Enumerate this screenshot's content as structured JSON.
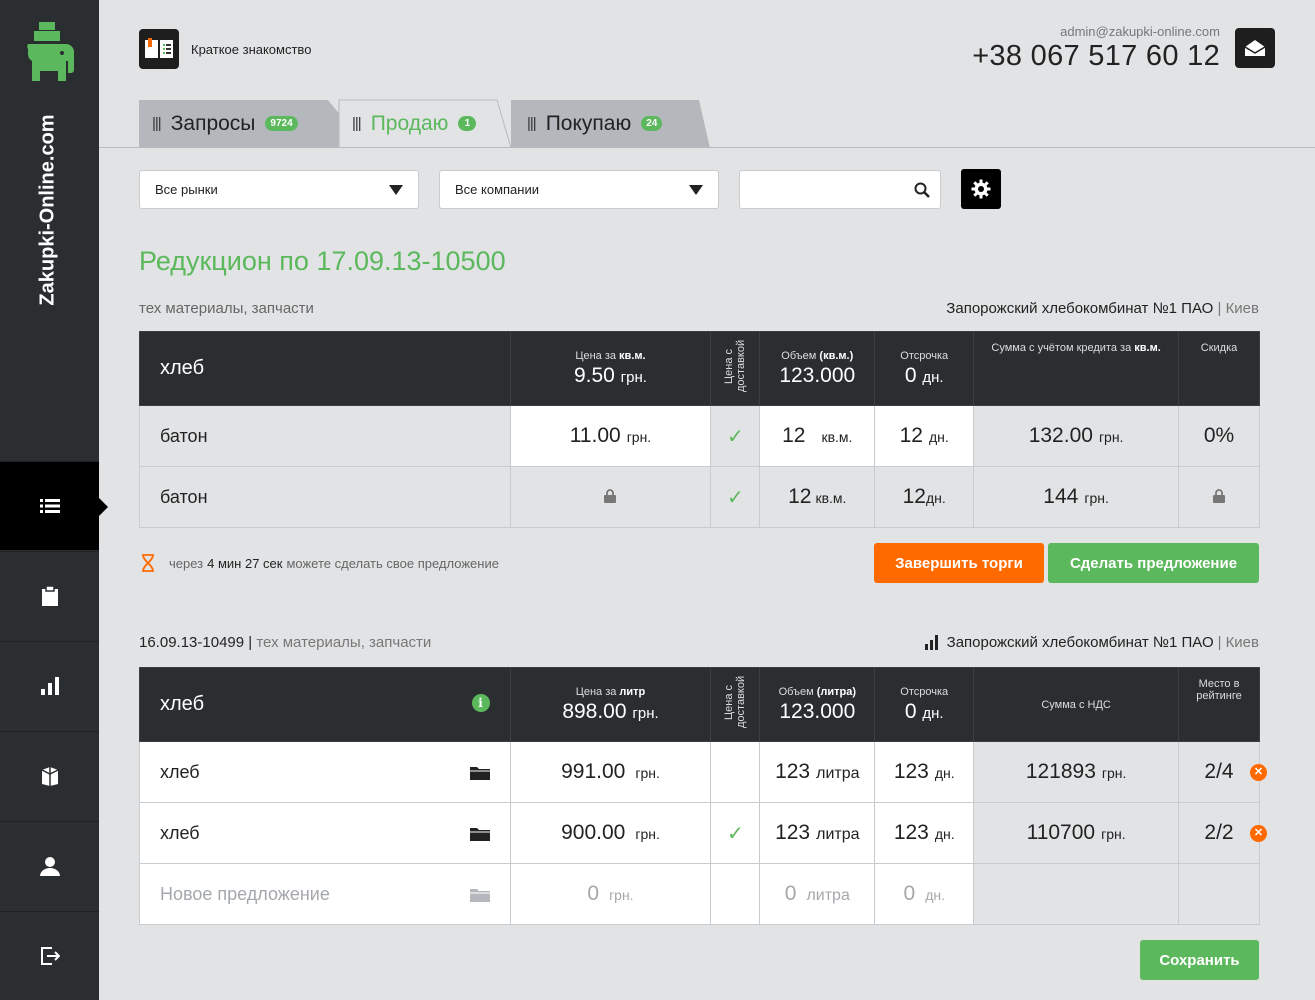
{
  "brand": "Zakupki-Online.com",
  "header": {
    "intro_label": "Краткое знакомство",
    "email": "admin@zakupki-online.com",
    "phone": "+38 067 517 60 12"
  },
  "tabs": [
    {
      "label": "Запросы",
      "badge": "9724"
    },
    {
      "label": "Продаю",
      "badge": "1"
    },
    {
      "label": "Покупаю",
      "badge": "24"
    }
  ],
  "filters": {
    "markets": "Все рынки",
    "companies": "Все компании",
    "search_value": ""
  },
  "auction": {
    "title": "Редукцион по 17.09.13-10500",
    "category": "тех материалы, запчасти",
    "company": "Запорожский хлебокомбинат №1 ПАО",
    "sep": "|",
    "city": "Киев",
    "head": {
      "name": "хлеб",
      "price_label": "Цена за",
      "price_unit_label": "кв.м.",
      "price": "9.50",
      "currency": "грн.",
      "delivery": "Цена с доставкой",
      "volume_label": "Объем",
      "volume_unit_label": "(кв.м.)",
      "volume": "123.000",
      "delay_label": "Отсрочка",
      "delay": "0",
      "days": "дн.",
      "sum_label": "Сумма с учётом кредита за",
      "sum_unit_label": "кв.м.",
      "discount_label": "Скидка"
    },
    "rows": [
      {
        "name": "батон",
        "price": "11.00",
        "currency": "грн.",
        "qty": "12",
        "unit": "кв.м.",
        "delay": "12",
        "days": "дн.",
        "sum": "132.00",
        "sum_currency": "грн.",
        "discount": "0%"
      },
      {
        "name": "батон",
        "qty": "12",
        "unit": "кв.м.",
        "delay": "12",
        "days": "дн.",
        "sum": "144",
        "sum_currency": "грн."
      }
    ],
    "timer_prefix": "через",
    "timer_value": "4 мин 27 сек",
    "timer_suffix": "можете сделать свое предложение",
    "btn_finish": "Завершить торги",
    "btn_offer": "Сделать предложение"
  },
  "request": {
    "id": "16.09.13-10499",
    "sep": "|",
    "category": "тех материалы, запчасти",
    "company": "Запорожский хлебокомбинат №1 ПАО",
    "city": "Киев",
    "head": {
      "name": "хлеб",
      "price_label": "Цена за",
      "price_unit_label": "литр",
      "price": "898.00",
      "currency": "грн.",
      "delivery": "Цена с доставкой",
      "volume_label": "Объем",
      "volume_unit_label": "(литра)",
      "volume": "123.000",
      "delay_label": "Отсрочка",
      "delay": "0",
      "days": "дн.",
      "sum_label": "Сумма с НДС",
      "rank_label": "Место в рейтинге"
    },
    "rows": [
      {
        "name": "хлеб",
        "price": "991.00",
        "currency": "грн.",
        "qty": "123",
        "unit": "литра",
        "delay": "123",
        "days": "дн.",
        "sum": "121893",
        "sum_currency": "грн.",
        "rank": "2/4"
      },
      {
        "name": "хлеб",
        "price": "900.00",
        "currency": "грн.",
        "qty": "123",
        "unit": "литра",
        "delay": "123",
        "days": "дн.",
        "sum": "110700",
        "sum_currency": "грн.",
        "rank": "2/2"
      }
    ],
    "new_row": {
      "name": "Новое предложение",
      "price": "0",
      "currency": "грн.",
      "qty": "0",
      "unit": "литра",
      "delay": "0",
      "days": "дн."
    },
    "btn_save": "Сохранить"
  },
  "colors": {
    "accent": "#5cb85c",
    "orange": "#ff6a00",
    "sidebar": "#2b2e30"
  }
}
